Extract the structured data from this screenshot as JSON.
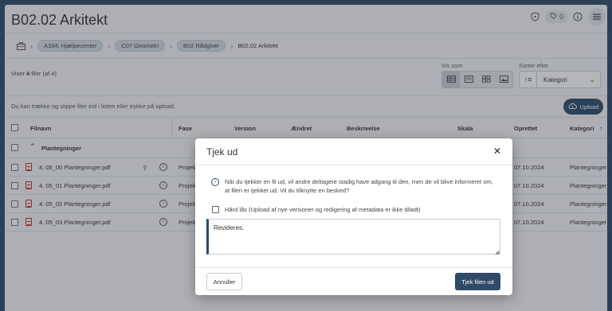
{
  "header": {
    "title": "B02.02 Arkitekt",
    "tag_count": "0"
  },
  "breadcrumb": {
    "items": [
      "A104: Hjælpecenter",
      "C07 Geometri",
      "B02 Rådgiver"
    ],
    "current": "B02.02 Arkitekt"
  },
  "toolbar": {
    "viser_prefix": "Viser ",
    "viser_count": "4",
    "viser_suffix": " filer (af 4)",
    "vis_som_label": "Vis som",
    "sorter_label": "Sorter efter",
    "sort_value": "Kategori"
  },
  "dropbar": {
    "text": "Du kan trække og slippe filer ind i listen eller trykke på upload.",
    "upload_label": "Upload"
  },
  "table": {
    "headers": {
      "filnavn": "Filnavn",
      "fase": "Fase",
      "version": "Version",
      "aendret": "Ændret",
      "beskrivelse": "Beskrivelse",
      "skala": "Skala",
      "oprettet": "Oprettet",
      "kategori": "Kategori"
    },
    "group": "Plantegninger",
    "rows": [
      {
        "name": "4. 05_00 Plantegninger.pdf",
        "fase": "Projek",
        "oprettet": "07.10.2024",
        "kategori": "Plantegninger"
      },
      {
        "name": "4. 05_01 Plantegninger.pdf",
        "fase": "Projek",
        "oprettet": "07.10.2024",
        "kategori": "Plantegninger"
      },
      {
        "name": "4. 05_02 Plantegninger.pdf",
        "fase": "Projek",
        "oprettet": "07.10.2024",
        "kategori": "Plantegninger"
      },
      {
        "name": "4. 05_03 Plantegninger.pdf",
        "fase": "Projek",
        "oprettet": "07.10.2024",
        "kategori": "Plantegninger"
      }
    ]
  },
  "modal": {
    "title": "Tjek ud",
    "info_text": "Når du tjekker en fil ud, vil andre deltagere stadig have adgang til den, men de vil blive informeret om, at filen er tjekket ud. Vil du tilknytte en besked?",
    "checkbox_label": "Hård lås (Upload af nye versioner og redigering af metadata er ikke tilladt)",
    "message_value": "Revideres.",
    "cancel_label": "Annuller",
    "confirm_label": "Tjek filen ud"
  }
}
